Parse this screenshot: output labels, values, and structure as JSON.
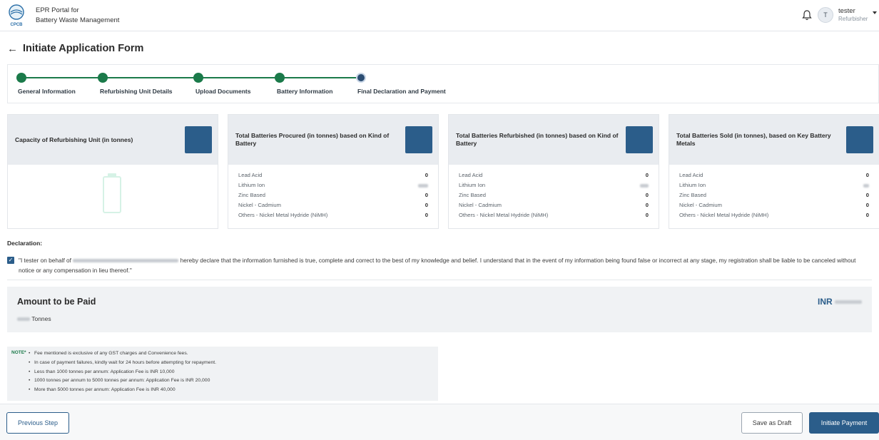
{
  "header": {
    "portal_line1": "EPR Portal for",
    "portal_line2": "Battery Waste Management",
    "logo_text": "CPCB",
    "user_initial": "T",
    "user_name": "tester",
    "user_role": "Refurbisher"
  },
  "page": {
    "title": "Initiate Application Form"
  },
  "stepper": {
    "steps": [
      {
        "label": "General Information",
        "status": "completed"
      },
      {
        "label": "Refurbishing Unit Details",
        "status": "completed"
      },
      {
        "label": "Upload Documents",
        "status": "completed"
      },
      {
        "label": "Battery Information",
        "status": "completed"
      },
      {
        "label": "Final Declaration and Payment",
        "status": "current"
      }
    ]
  },
  "cards": [
    {
      "title": "Capacity of Refurbishing Unit (in tonnes)"
    },
    {
      "title": "Total Batteries Procured (in tonnes) based on Kind of Battery",
      "rows": [
        {
          "label": "Lead Acid",
          "value": "0"
        },
        {
          "label": "Lithium Ion",
          "value": ""
        },
        {
          "label": "Zinc Based",
          "value": "0"
        },
        {
          "label": "Nickel - Cadmium",
          "value": "0"
        },
        {
          "label": "Others - Nickel Metal Hydride (NiMH)",
          "value": "0"
        }
      ]
    },
    {
      "title": "Total Batteries Refurbished (in tonnes) based on Kind of Battery",
      "rows": [
        {
          "label": "Lead Acid",
          "value": "0"
        },
        {
          "label": "Lithium Ion",
          "value": ""
        },
        {
          "label": "Zinc Based",
          "value": "0"
        },
        {
          "label": "Nickel - Cadmium",
          "value": "0"
        },
        {
          "label": "Others - Nickel Metal Hydride (NiMH)",
          "value": "0"
        }
      ]
    },
    {
      "title": "Total Batteries Sold (in tonnes), based on Key Battery Metals",
      "rows": [
        {
          "label": "Lead Acid",
          "value": "0"
        },
        {
          "label": "Lithium Ion",
          "value": ""
        },
        {
          "label": "Zinc Based",
          "value": "0"
        },
        {
          "label": "Nickel - Cadmium",
          "value": "0"
        },
        {
          "label": "Others - Nickel Metal Hydride (NiMH)",
          "value": "0"
        }
      ]
    }
  ],
  "declaration": {
    "label": "Declaration:",
    "text_before": "\"I tester on behalf of",
    "text_after": "hereby declare that the information furnished is true, complete and correct to the best of my knowledge and belief. I understand that in the event of my information being found false or incorrect at any stage, my registration shall be liable to be canceled without notice or any compensation in lieu thereof.\"",
    "checked": true
  },
  "amount": {
    "title": "Amount to be Paid",
    "tonnes_label": "Tonnes",
    "currency": "INR"
  },
  "note": {
    "tag": "NOTE*",
    "items": [
      "Fee mentioned is exclusive of any GST charges and Convenience fees.",
      "In case of payment failures, kindly wait for 24 hours before attempting for repayment.",
      "Less than 1000 tonnes per annum: Application Fee is INR 10,000",
      "1000 tonnes per annum to 5000 tonnes per annum: Application Fee is INR 20,000",
      "More than 5000 tonnes per annum: Application Fee is INR 40,000"
    ]
  },
  "footer": {
    "previous_label": "Previous Step",
    "draft_label": "Save as Draft",
    "pay_label": "Initiate Payment"
  },
  "colors": {
    "primary": "#2b5d8a",
    "step_complete": "#1b7a4a",
    "card_header": "#e9ecf0"
  }
}
